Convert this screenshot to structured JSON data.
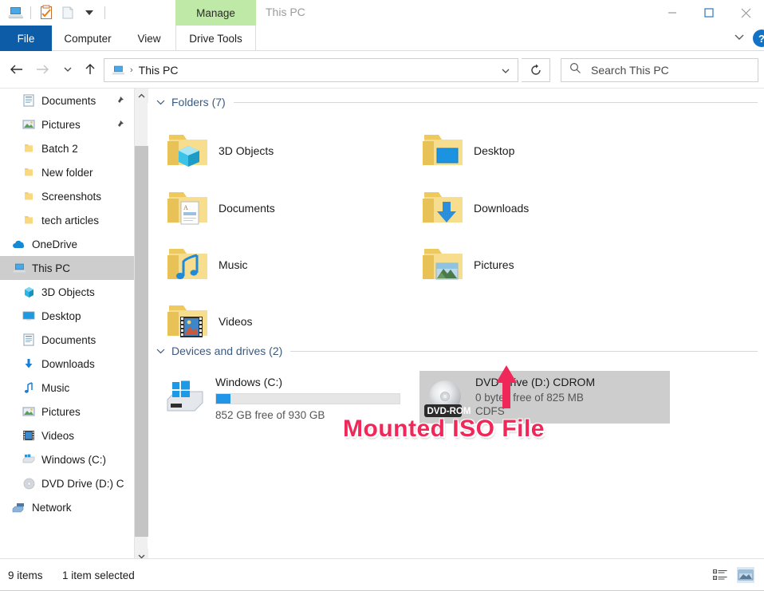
{
  "window": {
    "title": "This PC",
    "manage_tab": "Manage",
    "quick_access": [
      {
        "name": "this-pc-icon",
        "label": "This PC"
      },
      {
        "name": "properties-icon",
        "label": "Properties"
      },
      {
        "name": "new-folder-icon",
        "label": "New folder"
      },
      {
        "name": "customize-qat-icon",
        "label": "Customize Quick Access Toolbar"
      }
    ],
    "controls": {
      "minimize": "Minimize",
      "maximize": "Maximize",
      "close": "Close",
      "ribbon_expand": "Expand the Ribbon",
      "help": "?"
    }
  },
  "ribbon": {
    "tabs": [
      {
        "label": "File",
        "id": "file"
      },
      {
        "label": "Computer",
        "id": "computer"
      },
      {
        "label": "View",
        "id": "view"
      },
      {
        "label": "Drive Tools",
        "id": "drive-tools"
      }
    ]
  },
  "addressbar": {
    "back": "Back",
    "forward": "Forward",
    "recent": "Recent locations",
    "up": "Up",
    "breadcrumb": "This PC",
    "separator": "›",
    "refresh": "Refresh",
    "search_placeholder": "Search This PC"
  },
  "sidebar": {
    "items": [
      {
        "label": "Documents",
        "icon": "documents-icon",
        "indent": 1,
        "pinned": true,
        "selected": false
      },
      {
        "label": "Pictures",
        "icon": "pictures-icon",
        "indent": 1,
        "pinned": true,
        "selected": false
      },
      {
        "label": "Batch 2",
        "icon": "folder-icon",
        "indent": 1,
        "pinned": false,
        "selected": false
      },
      {
        "label": "New folder",
        "icon": "folder-icon",
        "indent": 1,
        "pinned": false,
        "selected": false
      },
      {
        "label": "Screenshots",
        "icon": "folder-icon",
        "indent": 1,
        "pinned": false,
        "selected": false
      },
      {
        "label": "tech articles",
        "icon": "folder-icon",
        "indent": 1,
        "pinned": false,
        "selected": false
      },
      {
        "label": "OneDrive",
        "icon": "onedrive-icon",
        "indent": 0,
        "pinned": false,
        "selected": false
      },
      {
        "label": "This PC",
        "icon": "this-pc-icon",
        "indent": 0,
        "pinned": false,
        "selected": true
      },
      {
        "label": "3D Objects",
        "icon": "3d-objects-icon",
        "indent": 1,
        "pinned": false,
        "selected": false
      },
      {
        "label": "Desktop",
        "icon": "desktop-icon",
        "indent": 1,
        "pinned": false,
        "selected": false
      },
      {
        "label": "Documents",
        "icon": "documents-icon",
        "indent": 1,
        "pinned": false,
        "selected": false
      },
      {
        "label": "Downloads",
        "icon": "downloads-icon",
        "indent": 1,
        "pinned": false,
        "selected": false
      },
      {
        "label": "Music",
        "icon": "music-icon",
        "indent": 1,
        "pinned": false,
        "selected": false
      },
      {
        "label": "Pictures",
        "icon": "pictures-icon",
        "indent": 1,
        "pinned": false,
        "selected": false
      },
      {
        "label": "Videos",
        "icon": "videos-icon",
        "indent": 1,
        "pinned": false,
        "selected": false
      },
      {
        "label": "Windows (C:)",
        "icon": "hdd-icon",
        "indent": 1,
        "pinned": false,
        "selected": false
      },
      {
        "label": "DVD Drive (D:) C",
        "icon": "dvd-icon",
        "indent": 1,
        "pinned": false,
        "selected": false
      },
      {
        "label": "Network",
        "icon": "network-icon",
        "indent": 0,
        "pinned": false,
        "selected": false
      }
    ]
  },
  "content": {
    "folders_section": {
      "title": "Folders (7)",
      "items": [
        {
          "label": "3D Objects",
          "icon": "folder-3d-objects-icon"
        },
        {
          "label": "Desktop",
          "icon": "folder-desktop-icon"
        },
        {
          "label": "Documents",
          "icon": "folder-documents-icon"
        },
        {
          "label": "Downloads",
          "icon": "folder-downloads-icon"
        },
        {
          "label": "Music",
          "icon": "folder-music-icon"
        },
        {
          "label": "Pictures",
          "icon": "folder-pictures-icon"
        },
        {
          "label": "Videos",
          "icon": "folder-videos-icon"
        }
      ]
    },
    "devices_section": {
      "title": "Devices and drives (2)",
      "drives": [
        {
          "name": "Windows (C:)",
          "icon": "windows-hdd-icon",
          "capacity_text": "852 GB free of 930 GB",
          "used_percent": 8,
          "selected": false
        },
        {
          "name": "DVD Drive (D:) CDROM",
          "icon": "dvd-rom-icon",
          "badge": "DVD-ROM",
          "capacity_text": "0 bytes free of 825 MB",
          "filesystem": "CDFS",
          "selected": true
        }
      ]
    }
  },
  "annotation": {
    "text": "Mounted ISO File",
    "color": "#f0285a",
    "arrow": "arrow-up"
  },
  "statusbar": {
    "item_count": "9 items",
    "selection": "1 item selected",
    "views": [
      {
        "name": "details-view-button",
        "label": "Details view",
        "active": false
      },
      {
        "name": "large-icons-view-button",
        "label": "Large icons view",
        "active": true
      }
    ]
  },
  "colors": {
    "file_tab": "#0c5ca8",
    "manage_tab": "#bfe9a6",
    "selection": "#cdcdcd",
    "section_header": "#3b5a80",
    "progress_blue": "#2196e8",
    "annotation_pink": "#f0285a"
  }
}
